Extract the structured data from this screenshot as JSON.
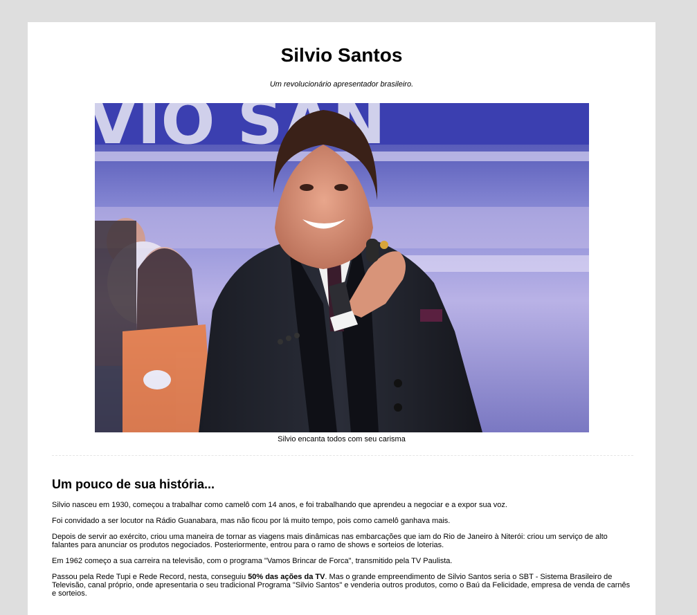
{
  "header": {
    "title": "Silvio Santos",
    "subtitle": "Um revolucionário apresentador brasileiro."
  },
  "figure": {
    "caption": "Silvio encanta todos com seu carisma"
  },
  "history": {
    "heading": "Um pouco de sua história...",
    "p1": "Silvio nasceu em 1930, começou a trabalhar como camelô com 14 anos, e foi trabalhando que aprendeu a negociar e a expor sua voz.",
    "p2": "Foi convidado a ser locutor na Rádio Guanabara, mas não ficou por lá muito tempo, pois como camelô ganhava mais.",
    "p3": "Depois de servir ao exército, criou uma maneira de tornar as viagens mais dinâmicas nas embarcações que iam do Rio de Janeiro à Niterói: criou um serviço de alto falantes para anunciar os produtos negociados. Posteriormente, entrou para o ramo de shows e sorteios de loterias.",
    "p4": "Em 1962 começo a sua carreira na televisão, com o programa \"Vamos Brincar de Forca\", transmitido pela TV Paulista.",
    "p5_before": "Passou pela Rede Tupi e Rede Record, nesta, conseguiu ",
    "p5_bold": "50% das ações da TV",
    "p5_after": ". Mas o grande empreendimento de Silvio Santos seria o SBT - Sistema Brasileiro de Televisão, canal próprio, onde apresentaria o seu tradicional Programa \"Silvio Santos\" e venderia outros produtos, como o Baú da Felicidade, empresa de venda de carnês e sorteios."
  }
}
